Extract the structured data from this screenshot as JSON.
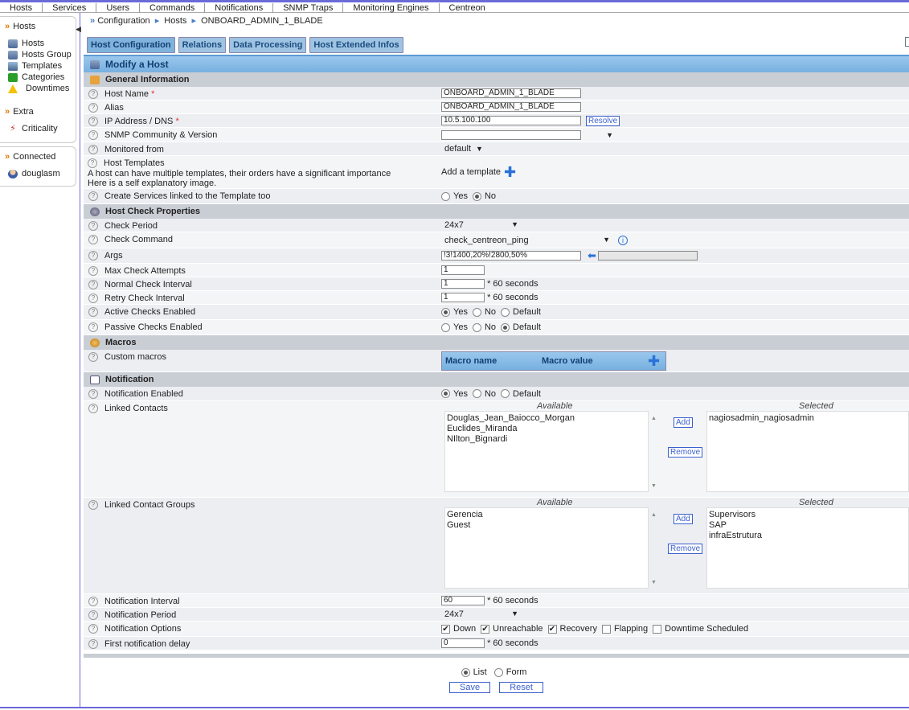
{
  "topmenu": [
    "Hosts",
    "Services",
    "Users",
    "Commands",
    "Notifications",
    "SNMP  Traps",
    "Monitoring  Engines",
    "Centreon"
  ],
  "sidebar": {
    "hosts_head": "Hosts",
    "items": [
      "Hosts",
      "Hosts Group",
      "Templates",
      "Categories",
      "Downtimes"
    ],
    "extra_head": "Extra",
    "extra_items": [
      "Criticality"
    ],
    "connected_head": "Connected",
    "user": "douglasm"
  },
  "breadcrumb": [
    "Configuration",
    "Hosts",
    "ONBOARD_ADMIN_1_BLADE"
  ],
  "tabs": [
    "Host Configuration",
    "Relations",
    "Data Processing",
    "Host Extended Infos"
  ],
  "form": {
    "title": "Modify a Host",
    "general": "General Information",
    "host_name_lbl": "Host Name",
    "host_name": "ONBOARD_ADMIN_1_BLADE",
    "alias_lbl": "Alias",
    "alias": "ONBOARD_ADMIN_1_BLADE",
    "ip_lbl": "IP Address / DNS",
    "ip": "10.5.100.100",
    "resolve": "Resolve",
    "snmp_lbl": "SNMP Community & Version",
    "monitored_lbl": "Monitored from",
    "monitored": "default",
    "templates_lbl": "Host Templates",
    "templates_note1": "A host can have multiple templates, their orders have a significant importance",
    "templates_note2": "Here is a self explanatory image.",
    "add_template": "Add a template",
    "create_services_lbl": "Create Services linked to the Template too",
    "yes": "Yes",
    "no": "No",
    "default": "Default",
    "check_props": "Host Check Properties",
    "check_period_lbl": "Check Period",
    "check_period": "24x7",
    "check_cmd_lbl": "Check Command",
    "check_cmd": "check_centreon_ping",
    "args_lbl": "Args",
    "args": "!3!1400,20%!2800,50%",
    "max_attempts_lbl": "Max Check Attempts",
    "max_attempts": "1",
    "normal_int_lbl": "Normal Check Interval",
    "normal_int": "1",
    "retry_int_lbl": "Retry Check Interval",
    "retry_int": "1",
    "seconds": "* 60 seconds",
    "active_lbl": "Active Checks Enabled",
    "passive_lbl": "Passive Checks Enabled",
    "macros": "Macros",
    "custom_macros_lbl": "Custom macros",
    "macro_name": "Macro name",
    "macro_value": "Macro value",
    "notification": "Notification",
    "notif_enabled_lbl": "Notification Enabled",
    "linked_contacts_lbl": "Linked Contacts",
    "available": "Available",
    "selected": "Selected",
    "contacts_available": [
      "Douglas_Jean_Baiocco_Morgan",
      "Euclides_Miranda",
      "NIlton_Bignardi"
    ],
    "contacts_selected": [
      "nagiosadmin_nagiosadmin"
    ],
    "add": "Add",
    "remove": "Remove",
    "linked_groups_lbl": "Linked Contact Groups",
    "groups_available": [
      "Gerencia",
      "Guest"
    ],
    "groups_selected": [
      "Supervisors",
      "SAP",
      "infraEstrutura"
    ],
    "notif_interval_lbl": "Notification Interval",
    "notif_interval": "60",
    "notif_period_lbl": "Notification Period",
    "notif_period": "24x7",
    "notif_options_lbl": "Notification Options",
    "opt_down": "Down",
    "opt_unreach": "Unreachable",
    "opt_recovery": "Recovery",
    "opt_flapping": "Flapping",
    "opt_downtime": "Downtime Scheduled",
    "first_delay_lbl": "First notification delay",
    "first_delay": "0"
  },
  "footer": {
    "list": "List",
    "form": "Form",
    "save": "Save",
    "reset": "Reset"
  }
}
